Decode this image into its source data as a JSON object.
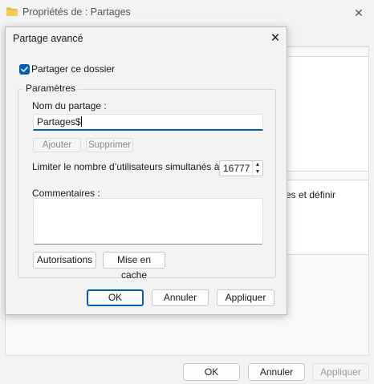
{
  "background_window": {
    "title": "Propriétés de : Partages",
    "partial_text": "es et définir",
    "buttons": {
      "ok": "OK",
      "cancel": "Annuler",
      "apply": "Appliquer"
    }
  },
  "dialog": {
    "title": "Partage avancé",
    "share_checkbox": {
      "label": "Partager ce dossier",
      "checked": true
    },
    "parameters": {
      "legend": "Paramètres",
      "share_name_label": "Nom du partage :",
      "share_name_value": "Partages$",
      "add_label": "Ajouter",
      "remove_label": "Supprimer",
      "limit_label": "Limiter le nombre d’utilisateurs simultanés à :",
      "limit_value": "16777",
      "comments_label": "Commentaires :",
      "comments_value": ""
    },
    "permissions_label": "Autorisations",
    "cache_label": "Mise en cache",
    "buttons": {
      "ok": "OK",
      "cancel": "Annuler",
      "apply": "Appliquer"
    }
  },
  "colors": {
    "accent": "#005fb8"
  },
  "icons": {
    "folder": "folder-icon",
    "close": "close-icon",
    "check": "checkmark-icon"
  }
}
